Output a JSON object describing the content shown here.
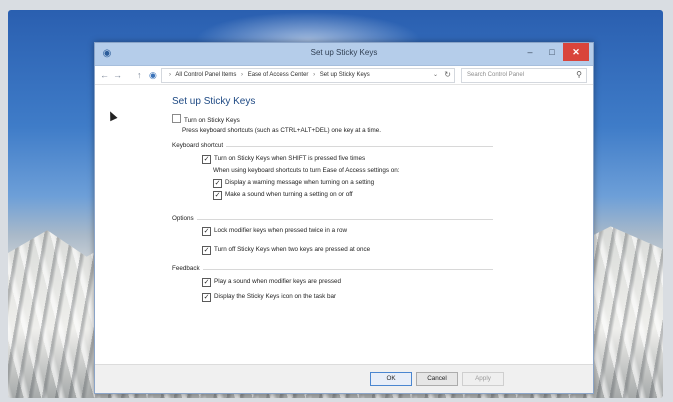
{
  "window": {
    "title": "Set up Sticky Keys",
    "controls": {
      "minimize": "–",
      "maximize": "□",
      "close": "✕"
    }
  },
  "address": {
    "breadcrumb": [
      "All Control Panel Items",
      "Ease of Access Center",
      "Set up Sticky Keys"
    ],
    "search_placeholder": "Search Control Panel"
  },
  "main": {
    "heading": "Set up Sticky Keys",
    "turn_on": {
      "label": "Turn on Sticky Keys",
      "checked": false
    },
    "turn_on_desc": "Press keyboard shortcuts (such as CTRL+ALT+DEL) one key at a time.",
    "keyboard_shortcut": {
      "section_label": "Keyboard shortcut",
      "shift_five": {
        "label": "Turn on Sticky Keys when SHIFT is pressed five times",
        "checked": true
      },
      "subtext": "When using keyboard shortcuts to turn Ease of Access settings on:",
      "warning": {
        "label": "Display a warning message when turning on a setting",
        "checked": true
      },
      "sound": {
        "label": "Make a sound when turning a setting on or off",
        "checked": true
      }
    },
    "options": {
      "section_label": "Options",
      "lock_modifier": {
        "label": "Lock modifier keys when pressed twice in a row",
        "checked": true
      },
      "turn_off_two": {
        "label": "Turn off Sticky Keys when two keys are pressed at once",
        "checked": true
      }
    },
    "feedback": {
      "section_label": "Feedback",
      "play_sound": {
        "label": "Play a sound when modifier keys are pressed",
        "checked": true
      },
      "taskbar_icon": {
        "label": "Display the Sticky Keys icon on the task bar",
        "checked": true
      }
    }
  },
  "footer": {
    "ok": "OK",
    "cancel": "Cancel",
    "apply": "Apply"
  },
  "colors": {
    "heading": "#1f4a84",
    "titlebar": "#b5cdea",
    "close": "#d9443b"
  },
  "icons": {
    "check_mark": "✓",
    "back": "←",
    "forward": "→",
    "up": "↑",
    "dropdown": "⌄",
    "refresh": "↻",
    "search": "⚲"
  }
}
